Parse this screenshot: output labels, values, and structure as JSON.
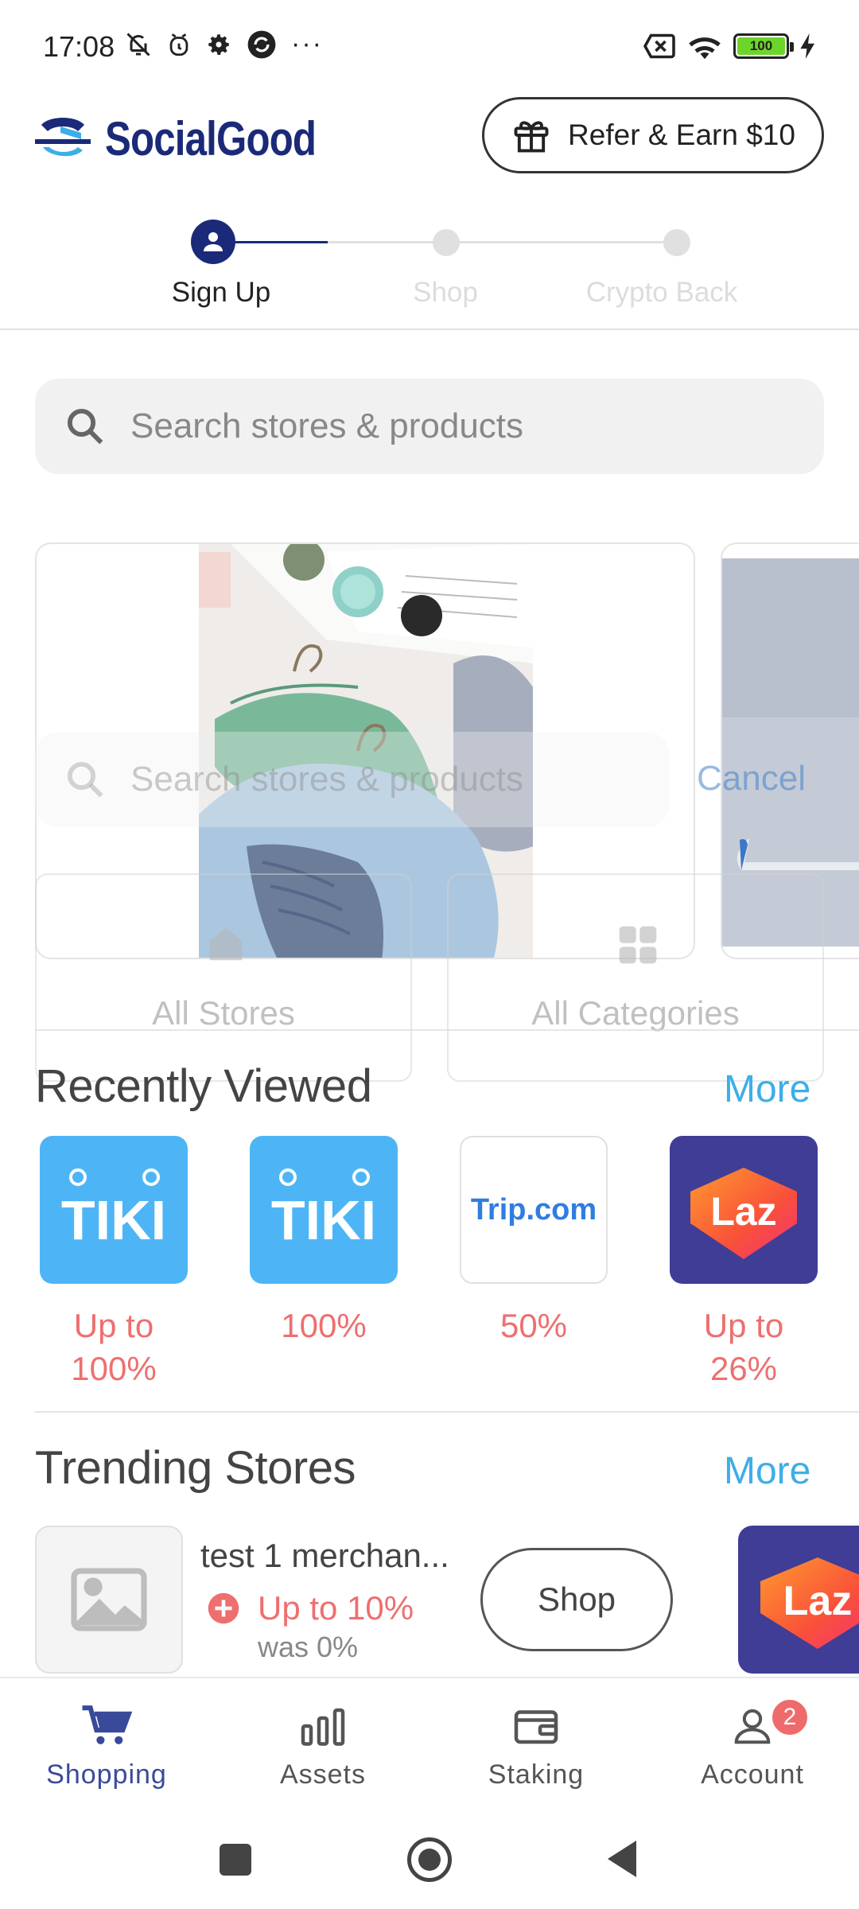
{
  "status_bar": {
    "time": "17:08",
    "battery_level": "100"
  },
  "header": {
    "brand_name": "SocialGood",
    "refer_label": "Refer & Earn $10"
  },
  "stepper": {
    "steps": [
      {
        "label": "Sign Up",
        "active": true
      },
      {
        "label": "Shop",
        "active": false
      },
      {
        "label": "Crypto Back",
        "active": false
      }
    ]
  },
  "search": {
    "placeholder": "Search stores & products"
  },
  "overlay": {
    "search_placeholder": "Search stores & products",
    "cancel_label": "Cancel",
    "all_stores_label": "All Stores",
    "all_categories_label": "All Categories"
  },
  "recently_viewed": {
    "title": "Recently Viewed",
    "more_label": "More",
    "stores": [
      {
        "logo_text": "TIKI",
        "cashback_line1": "Up to",
        "cashback_line2": "100%"
      },
      {
        "logo_text": "TIKI",
        "cashback_line1": "100%",
        "cashback_line2": ""
      },
      {
        "logo_text": "Trip.com",
        "cashback_line1": "50%",
        "cashback_line2": ""
      },
      {
        "logo_text": "Laz",
        "cashback_line1": "Up to",
        "cashback_line2": "26%"
      }
    ]
  },
  "trending": {
    "title": "Trending Stores",
    "more_label": "More",
    "item": {
      "name": "test 1 merchan...",
      "cashback": "Up to 10%",
      "was": "was 0%",
      "shop_label": "Shop"
    },
    "next_logo_text": "Laz"
  },
  "bottom_nav": {
    "items": [
      {
        "label": "Shopping",
        "active": true
      },
      {
        "label": "Assets",
        "active": false
      },
      {
        "label": "Staking",
        "active": false
      },
      {
        "label": "Account",
        "active": false,
        "badge": "2"
      }
    ]
  },
  "colors": {
    "brand_navy": "#1b2a78",
    "accent_blue": "#3daee9",
    "cashback_red": "#ee6f6f",
    "tiki_blue": "#4db5f5",
    "laz_purple": "#3f3d96",
    "nav_active": "#3a4a9a"
  }
}
